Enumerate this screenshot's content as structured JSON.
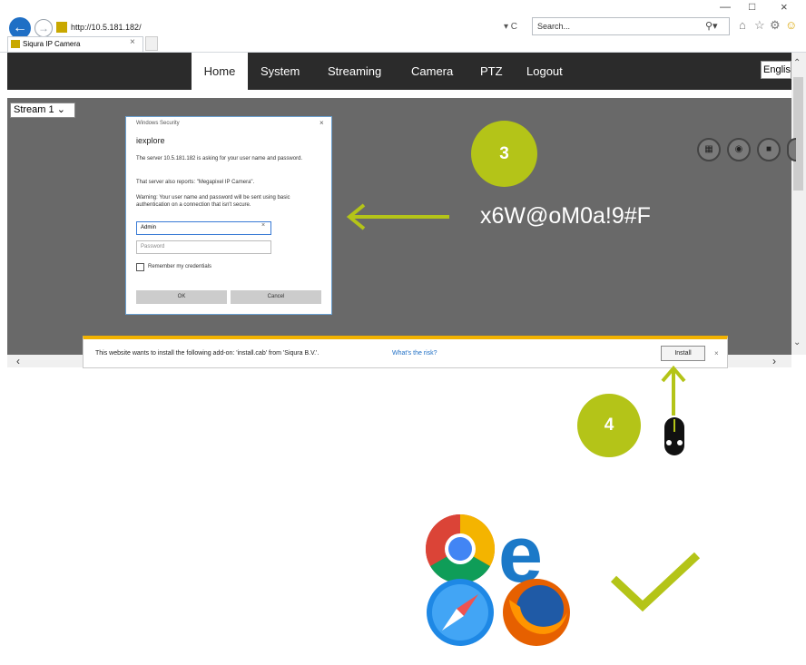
{
  "browser": {
    "url": "http://10.5.181.182/",
    "address_controls": "▾ C",
    "search_placeholder": "Search...",
    "tab_title": "Siqura IP Camera",
    "tab_close": "×",
    "window_controls": [
      "—",
      "□",
      "×"
    ],
    "toolbar_icons": [
      "home-icon",
      "star-icon",
      "gear-icon",
      "smiley-icon"
    ],
    "nav_icons": [
      "back-arrow-icon",
      "forward-arrow-icon",
      "favicon-icon"
    ]
  },
  "nav": {
    "items": [
      "Home",
      "System",
      "Streaming",
      "Camera",
      "PTZ",
      "Logout"
    ],
    "active": "Home",
    "language": "English"
  },
  "content": {
    "stream_select": "Stream 1",
    "control_icons": [
      "fullscreen-icon",
      "snapshot-icon",
      "stop-icon",
      "record-icon"
    ]
  },
  "dialog": {
    "title": "Windows Security",
    "app": "iexplore",
    "message1": "The server 10.5.181.182 is asking for your user name and password.",
    "message2": "That server also reports: \"Megapixel IP Camera\".",
    "message3": "Warning: Your user name and password will be sent using basic authentication on a connection that isn't secure.",
    "username_value": "Admin",
    "username_clear": "×",
    "password_placeholder": "Password",
    "remember_label": "Remember my credentials",
    "ok_label": "OK",
    "cancel_label": "Cancel",
    "close": "×"
  },
  "notification": {
    "text": "This website wants to install the following add-on: 'install.cab' from 'Siqura B.V.'.",
    "risk_link": "What's the risk?",
    "install_label": "Install",
    "close": "×"
  },
  "annotations": {
    "step3": "3",
    "step4": "4",
    "password_hint": "x6W@oM0a!9#F",
    "accent_color": "#b4c418"
  },
  "browsers_supported": [
    "chrome-icon",
    "edge-icon",
    "safari-icon",
    "firefox-icon"
  ]
}
